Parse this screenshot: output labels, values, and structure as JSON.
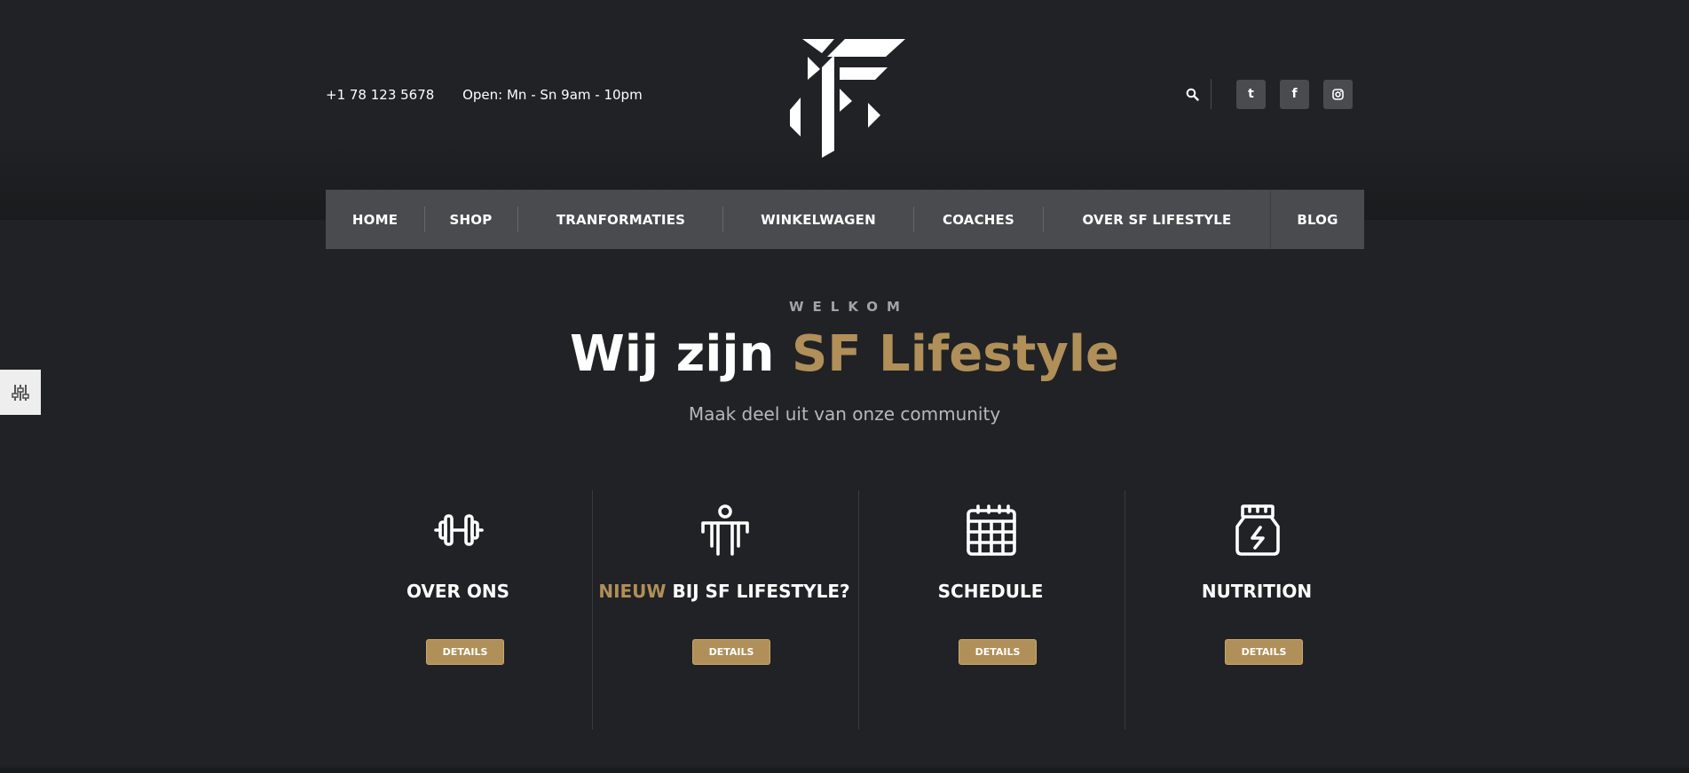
{
  "header": {
    "phone": "+1 78 123 5678",
    "hours": "Open: Mn - Sn 9am - 10pm",
    "social": [
      {
        "icon": "tumblr-icon",
        "glyph": "t"
      },
      {
        "icon": "facebook-icon",
        "glyph": "f"
      },
      {
        "icon": "instagram-icon",
        "glyph": ""
      }
    ]
  },
  "nav": {
    "items": [
      "HOME",
      "SHOP",
      "TRANFORMATIES",
      "WINKELWAGEN",
      "COACHES",
      "OVER SF LIFESTYLE",
      "BLOG"
    ]
  },
  "hero": {
    "eyebrow": "WELKOM",
    "title_prefix": "Wij zijn ",
    "title_highlight": "SF Lifestyle",
    "subtitle": "Maak deel uit van onze community"
  },
  "features": [
    {
      "icon": "dumbbell-icon",
      "title_highlight": "",
      "title": "OVER ONS",
      "button": "DETAILS"
    },
    {
      "icon": "person-fitness-icon",
      "title_highlight": "NIEUW",
      "title": " BIJ SF LIFESTYLE?",
      "button": "DETAILS"
    },
    {
      "icon": "calendar-icon",
      "title_highlight": "",
      "title": "SCHEDULE",
      "button": "DETAILS"
    },
    {
      "icon": "supplement-jar-icon",
      "title_highlight": "",
      "title": "NUTRITION",
      "button": "DETAILS"
    }
  ],
  "colors": {
    "background": "#212225",
    "accent": "#b08f58",
    "nav": "#4a4b4e"
  }
}
